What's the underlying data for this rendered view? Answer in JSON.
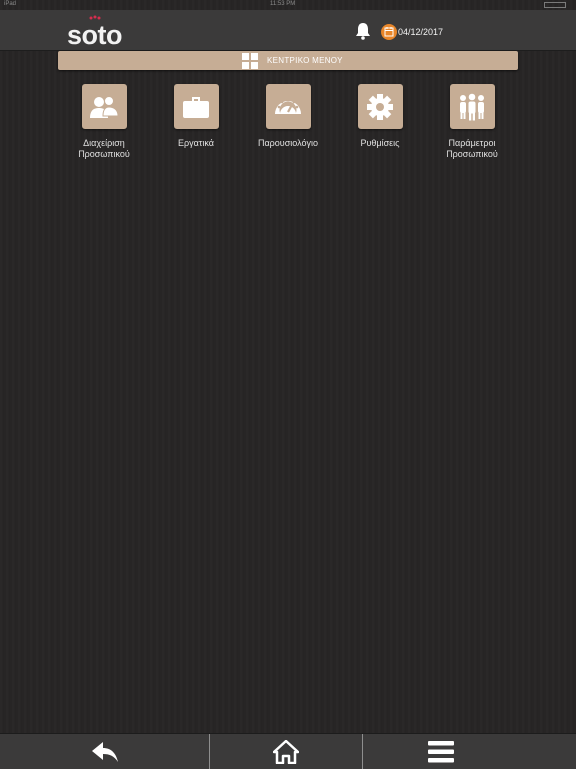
{
  "status_bar": {
    "carrier": "iPad",
    "time": "11:53 PM",
    "battery": ""
  },
  "header": {
    "logo_text": "soto",
    "date": "04/12/2017"
  },
  "menu_bar": {
    "title": "ΚΕΝΤΡΙΚΟ ΜΕΝΟΥ"
  },
  "tiles": [
    {
      "label_line1": "Διαχείριση",
      "label_line2": "Προσωπικού",
      "icon": "users-icon"
    },
    {
      "label_line1": "Εργατικά",
      "label_line2": "",
      "icon": "briefcase-icon"
    },
    {
      "label_line1": "Παρουσιολόγιο",
      "label_line2": "",
      "icon": "gauge-icon"
    },
    {
      "label_line1": "Ρυθμίσεις",
      "label_line2": "",
      "icon": "gear-icon"
    },
    {
      "label_line1": "Παράμετροι",
      "label_line2": "Προσωπικού",
      "icon": "staff-group-icon"
    }
  ],
  "footer": {
    "icons": [
      "back-arrow-icon",
      "home-icon",
      "hamburger-menu-icon"
    ]
  },
  "colors": {
    "accent": "#c6ad95",
    "header": "#3b3a3a",
    "background": "#272525",
    "badge": "#e8862a"
  }
}
